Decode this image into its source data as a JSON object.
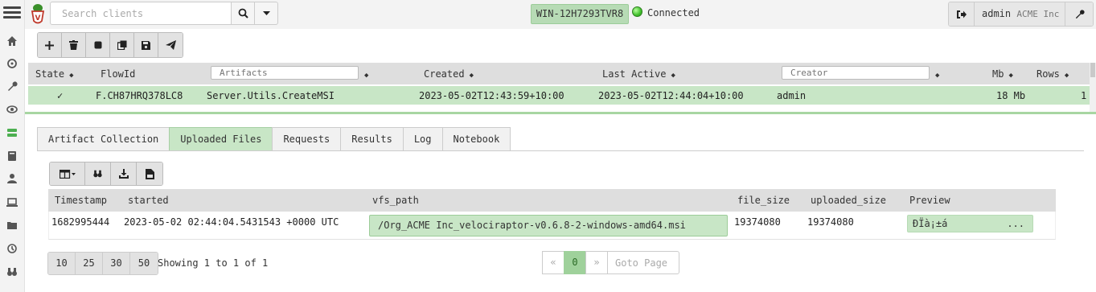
{
  "topbar": {
    "search_placeholder": "Search clients",
    "hostname": "WIN-12H7293TVR8",
    "connection_status": "Connected",
    "user": "admin",
    "org": "ACME Inc"
  },
  "sidebar": {
    "items": [
      "home-icon",
      "crosshair-icon",
      "wrench-icon",
      "eye-icon",
      "server-icon",
      "book-icon",
      "user-icon",
      "laptop-icon",
      "folder-icon",
      "history-icon",
      "binoculars-icon"
    ]
  },
  "flows": {
    "columns": {
      "state": "State",
      "flow_id": "FlowId",
      "artifacts_placeholder": "Artifacts",
      "created": "Created",
      "last_active": "Last Active",
      "creator_placeholder": "Creator",
      "mb": "Mb",
      "rows": "Rows"
    },
    "rows": [
      {
        "state": "✓",
        "flow_id": "F.CH87HRQ378LC8",
        "artifact": "Server.Utils.CreateMSI",
        "created": "2023-05-02T12:43:59+10:00",
        "last_active": "2023-05-02T12:44:04+10:00",
        "creator": "admin",
        "mb": "18 Mb",
        "rows": "1"
      }
    ]
  },
  "tabs": [
    "Artifact Collection",
    "Uploaded Files",
    "Requests",
    "Results",
    "Log",
    "Notebook"
  ],
  "active_tab": "Uploaded Files",
  "uploads": {
    "columns": {
      "timestamp": "Timestamp",
      "started": "started",
      "vfs_path": "vfs_path",
      "file_size": "file_size",
      "uploaded_size": "uploaded_size",
      "preview": "Preview"
    },
    "rows": [
      {
        "timestamp": "1682995444",
        "started": "2023-05-02 02:44:04.5431543 +0000 UTC",
        "vfs_path": "/Org_ACME Inc_velociraptor-v0.6.8-2-windows-amd64.msi",
        "file_size": "19374080",
        "uploaded_size": "19374080",
        "preview": "ÐÏà¡±á",
        "preview_more": "..."
      }
    ]
  },
  "pagination": {
    "page_sizes": [
      "10",
      "25",
      "30",
      "50"
    ],
    "showing": "Showing 1 to 1 of 1",
    "prev": "«",
    "current": "0",
    "next": "»",
    "goto_placeholder": "Goto Page"
  },
  "colors": {
    "accent": "#c8e6c6",
    "accent_border": "#9ccc99",
    "header_bg": "#dedede",
    "chrome_bg": "#f3f3f3"
  }
}
